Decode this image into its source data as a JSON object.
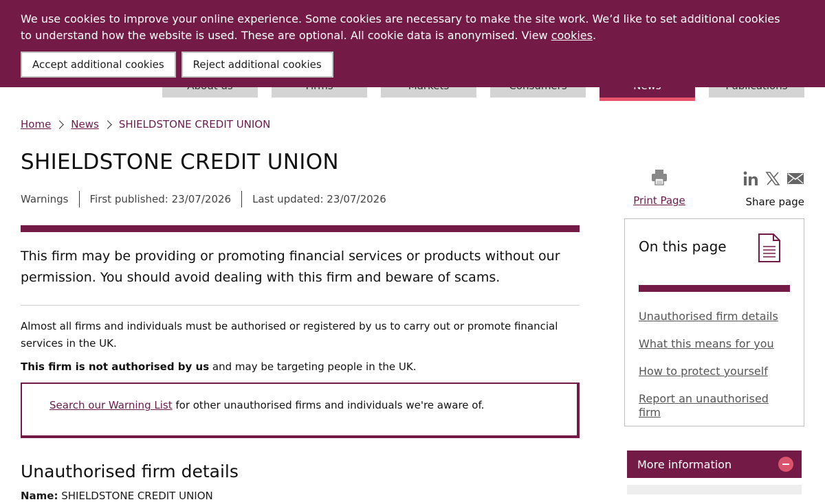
{
  "cookie_banner": {
    "text": "We use cookies to improve your online experience. Some cookies are necessary to make the site work. We’d like to set additional cookies to understand how the website is used. These are optional. All cookie data is anonymised. View ",
    "link": "cookies",
    "trailing": ".",
    "accept_label": "Accept additional cookies",
    "reject_label": "Reject additional cookies"
  },
  "nav": {
    "tabs": [
      {
        "label": "About us"
      },
      {
        "label": "Firms"
      },
      {
        "label": "Markets"
      },
      {
        "label": "Consumers"
      },
      {
        "label": "News"
      },
      {
        "label": "Publications"
      }
    ],
    "active_index": 4
  },
  "breadcrumb": {
    "home": "Home",
    "news": "News",
    "current": "SHIELDSTONE CREDIT UNION"
  },
  "page": {
    "title": "SHIELDSTONE CREDIT UNION",
    "category": "Warnings",
    "first_published": "First published: 23/07/2026",
    "last_updated": "Last updated: 23/07/2026",
    "lead": "This firm may be providing or promoting financial services or products without our permission. You should avoid dealing with this firm and beware of scams.",
    "para1": "Almost all firms and individuals must be authorised or registered by us to carry out or promote financial services in the UK.",
    "para2_bold": "This firm is not authorised by us",
    "para2_rest": " and may be targeting people in the UK.",
    "callout_link": "Search our Warning List",
    "callout_rest": " for other unauthorised firms and individuals we're aware of.",
    "section_heading": "Unauthorised firm details",
    "name_label": "Name:",
    "name_value": " SHIELDSTONE CREDIT UNION"
  },
  "tools": {
    "print_label": "Print Page",
    "share_label": "Share page",
    "icons": [
      "printer-icon",
      "linkedin-icon",
      "x-icon",
      "email-icon"
    ]
  },
  "on_this_page": {
    "title": "On this page",
    "icon": "document-icon",
    "links": [
      {
        "label": "Unauthorised firm details"
      },
      {
        "label": "What this means for you"
      },
      {
        "label": "How to protect yourself"
      },
      {
        "label": "Report an unauthorised firm"
      }
    ]
  },
  "more_info": {
    "label": "More information",
    "icon": "minus-icon"
  },
  "colors": {
    "brand": "#731b46",
    "accent": "#e5546a",
    "link": "#6a1a4a"
  }
}
